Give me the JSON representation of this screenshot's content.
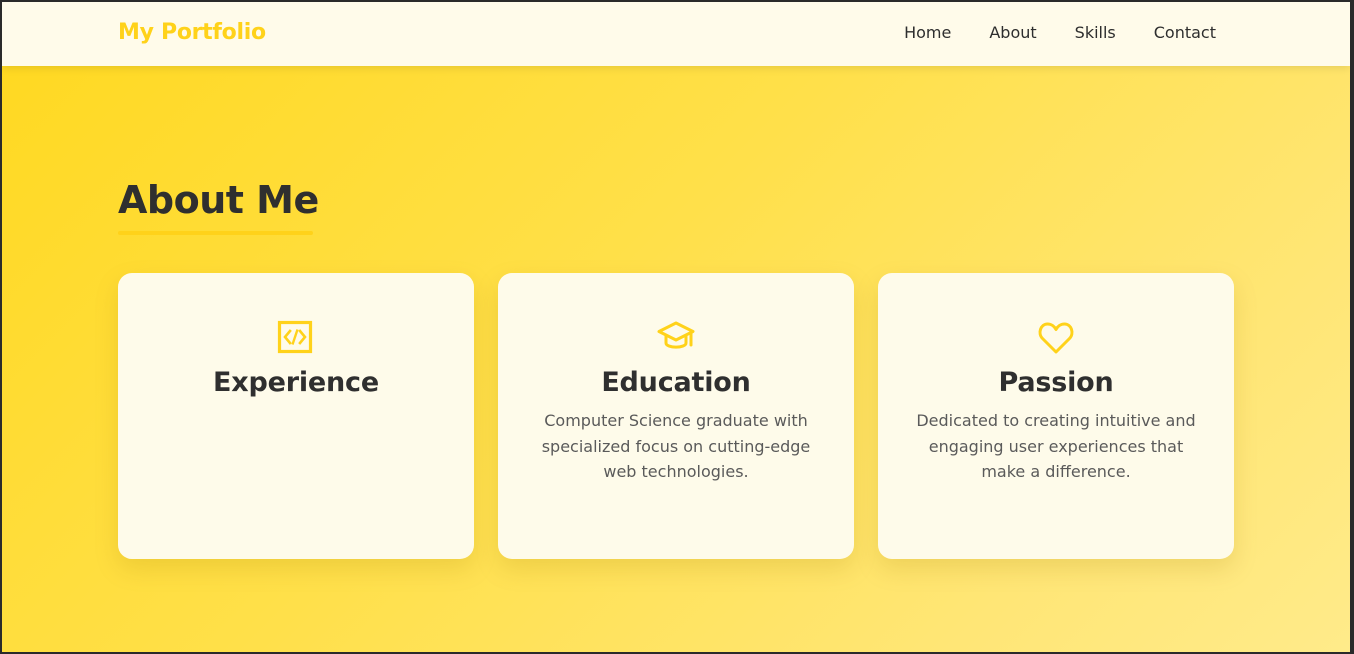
{
  "brand": {
    "logo": "My Portfolio",
    "accent_color": "#ffd21a"
  },
  "nav": {
    "items": [
      {
        "label": "Home"
      },
      {
        "label": "About"
      },
      {
        "label": "Skills"
      },
      {
        "label": "Contact"
      }
    ]
  },
  "about": {
    "title": "About Me",
    "cards": [
      {
        "icon": "code-icon",
        "title": "Experience",
        "text": ""
      },
      {
        "icon": "graduation-cap-icon",
        "title": "Education",
        "text": "Computer Science graduate with specialized focus on cutting-edge web technologies."
      },
      {
        "icon": "heart-icon",
        "title": "Passion",
        "text": "Dedicated to creating intuitive and engaging user experiences that make a difference."
      }
    ]
  }
}
